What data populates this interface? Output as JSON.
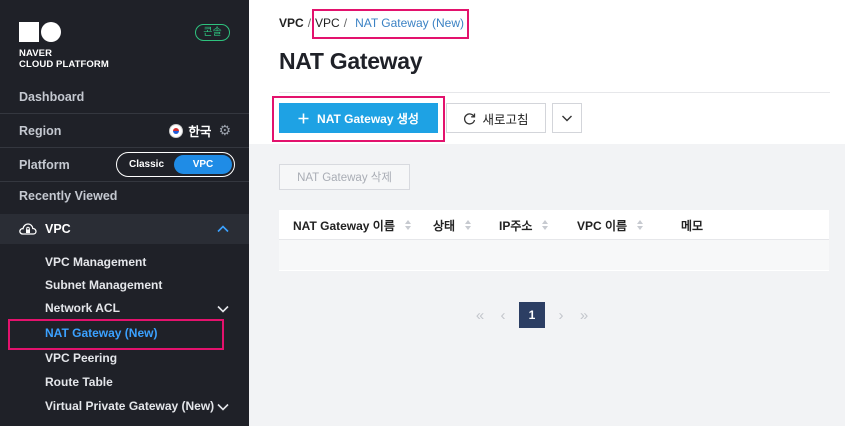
{
  "brand": {
    "line1": "NAVER",
    "line2": "CLOUD PLATFORM",
    "console_label": "콘솔"
  },
  "nav": {
    "dashboard": "Dashboard",
    "region_label": "Region",
    "region_value": "한국",
    "platform_label": "Platform",
    "platform_options": [
      "Classic",
      "VPC"
    ],
    "platform_selected": "VPC",
    "recently_viewed": "Recently Viewed",
    "vpc_section": "VPC",
    "submenu": [
      "VPC Management",
      "Subnet Management",
      "Network ACL",
      "NAT Gateway (New)",
      "VPC Peering",
      "Route Table",
      "Virtual Private Gateway (New)"
    ],
    "active_item": "NAT Gateway (New)"
  },
  "breadcrumb": [
    "VPC",
    "VPC",
    "NAT Gateway (New)"
  ],
  "page": {
    "title": "NAT Gateway"
  },
  "toolbar": {
    "create_label": "NAT Gateway 생성",
    "refresh_label": "새로고침",
    "delete_label": "NAT Gateway 삭제"
  },
  "table": {
    "columns": [
      "NAT Gateway 이름",
      "상태",
      "IP주소",
      "VPC 이름",
      "메모"
    ],
    "rows": []
  },
  "pagination": {
    "current_page": "1"
  },
  "colors": {
    "sidebar_bg": "#1f2128",
    "accent": "#1ea2e4",
    "active_link": "#3ba1ff",
    "highlight": "#e3126d",
    "page_btn": "#2c3e63"
  }
}
